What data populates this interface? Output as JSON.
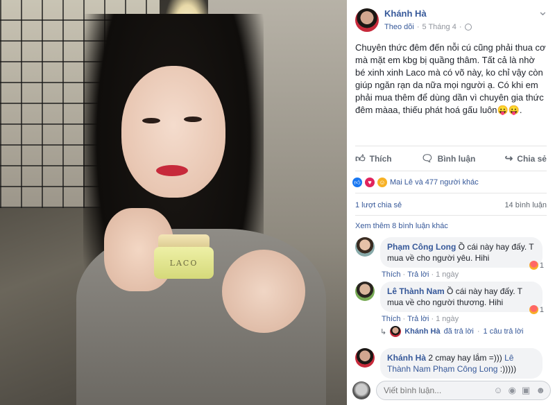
{
  "post": {
    "author": "Khánh Hà",
    "follow_label": "Theo dõi",
    "separator": "·",
    "date": "5 Tháng 4",
    "dropdown_glyph": "·",
    "text": "Chuyên thức đêm đến nỗi cú cũng phải thua cơ mà mặt em kbg bị quầng thâm. Tất cả là nhờ bé xinh xinh Laco mà có võ này, ko chỉ vậy còn giúp ngăn rạn da nữa mọi người ạ. Có khi em phải mua thêm để dùng dần vì chuyên gia thức đêm màaa, thiếu phát hoá gấu luôn😛😛.",
    "product_brand": "LACO"
  },
  "actions": {
    "like": "Thích",
    "comment": "Bình luận",
    "share": "Chia sẻ"
  },
  "reactions": {
    "summary": "Mai Lê và 477 người khác"
  },
  "stats": {
    "shares": "1 lượt chia sẻ",
    "comments": "14 bình luận"
  },
  "more_comments": "Xem thêm 8 bình luận khác",
  "comments": [
    {
      "name": "Phạm Công Long",
      "text": "Ồ cái này hay đấy. T mua về cho người yêu. Hihi",
      "like": "Thích",
      "reply": "Trả lời",
      "time": "1 ngày",
      "reaction_count": "1"
    },
    {
      "name": "Lê Thành Nam",
      "text": "Ồ cái này hay đấy. T mua về cho người thương. Hihi",
      "like": "Thích",
      "reply": "Trả lời",
      "time": "1 ngày",
      "reaction_count": "1"
    },
    {
      "name": "Khánh Hà",
      "text": "2 cmay hay lắm =)))",
      "tag": "Lê Thành Nam Phạm Công Long",
      "text_after": ":)))))"
    }
  ],
  "reply_summary": {
    "who": "Khánh Hà",
    "action": "đã trả lời",
    "dot": "·",
    "count": "1 câu trả lời"
  },
  "composer": {
    "placeholder": "Viết bình luận..."
  },
  "colors": {
    "link": "#365899",
    "like_blue": "#1877f2",
    "love_red": "#e0245e",
    "haha_yellow": "#f7b125"
  }
}
